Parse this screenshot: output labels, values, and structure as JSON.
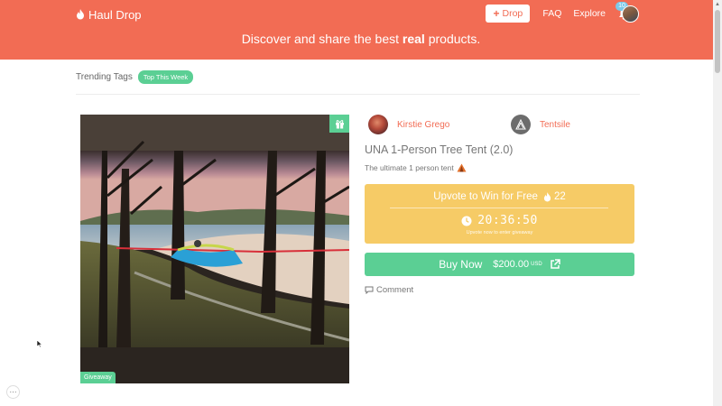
{
  "header": {
    "brand": "Haul Drop",
    "drop_label": "Drop",
    "nav": {
      "faq": "FAQ",
      "explore": "Explore",
      "notif_count": "10"
    },
    "tagline_pre": "Discover and share the best ",
    "tagline_bold": "real",
    "tagline_post": " products.",
    "color": "#f26c54"
  },
  "trending": {
    "label": "Trending Tags",
    "tag": "Top This Week"
  },
  "product": {
    "badge_gift_icon": "gift-icon",
    "giveaway_label": "Giveaway",
    "user_name": "Kirstie Grego",
    "brand_name": "Tentsile",
    "title": "UNA 1-Person Tree Tent (2.0)",
    "description": "The ultimate 1 person tent",
    "upvote_label": "Upvote to Win for Free",
    "upvote_count": "22",
    "timer": "20:36:50",
    "timer_sub": "Upvote now to enter giveaway",
    "buy_label": "Buy Now",
    "price": "$200.00",
    "currency": "USD",
    "comment_label": "Comment"
  },
  "colors": {
    "accent": "#f26c54",
    "green": "#5bcf94",
    "yellow": "#f6cb66"
  },
  "more_label": "···"
}
